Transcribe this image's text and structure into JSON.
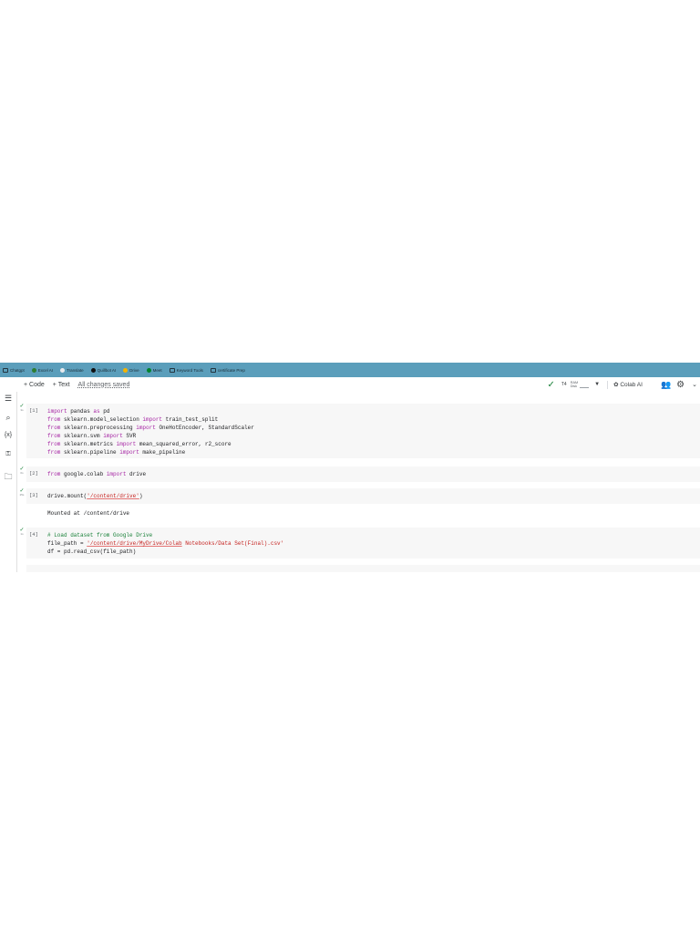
{
  "bookmarks": [
    {
      "label": "Chatgpt",
      "icon": "folder-icon",
      "color": "#24343f"
    },
    {
      "label": "Excel AI",
      "icon": "sparkle-icon",
      "color": "#2e7d32"
    },
    {
      "label": "Translate",
      "icon": "translate-icon",
      "color": "#e8eaed"
    },
    {
      "label": "Quillbot AI",
      "icon": "quillbot-icon",
      "color": "#111111"
    },
    {
      "label": "Drive",
      "icon": "drive-icon",
      "color": "#f4b400"
    },
    {
      "label": "Meet",
      "icon": "meet-icon",
      "color": "#00832d"
    },
    {
      "label": "Keyword Tools",
      "icon": "folder-icon",
      "color": "#24343f"
    },
    {
      "label": "certificate Prep",
      "icon": "folder-icon",
      "color": "#24343f"
    }
  ],
  "toolbar": {
    "add_code": "+ Code",
    "add_text": "+ Text",
    "status": "All changes saved",
    "runtime_type": "T4",
    "ram_label": "RAM",
    "disk_label": "Disk",
    "colab_ai": "Colab AI"
  },
  "cells": [
    {
      "number": "[1]",
      "time": "3s",
      "lines": [
        [
          {
            "t": "import",
            "c": "kw"
          },
          {
            "t": " pandas "
          },
          {
            "t": "as",
            "c": "kw"
          },
          {
            "t": " pd"
          }
        ],
        [
          {
            "t": "from",
            "c": "kw"
          },
          {
            "t": " sklearn.model_selection "
          },
          {
            "t": "import",
            "c": "kw"
          },
          {
            "t": " train_test_split"
          }
        ],
        [
          {
            "t": "from",
            "c": "kw"
          },
          {
            "t": " sklearn.preprocessing "
          },
          {
            "t": "import",
            "c": "kw"
          },
          {
            "t": " OneHotEncoder, StandardScaler"
          }
        ],
        [
          {
            "t": "from",
            "c": "kw"
          },
          {
            "t": " sklearn.svm "
          },
          {
            "t": "import",
            "c": "kw"
          },
          {
            "t": " SVR"
          }
        ],
        [
          {
            "t": "from",
            "c": "kw"
          },
          {
            "t": " sklearn.metrics "
          },
          {
            "t": "import",
            "c": "kw"
          },
          {
            "t": " mean_squared_error, r2_score"
          }
        ],
        [
          {
            "t": "from",
            "c": "kw"
          },
          {
            "t": " sklearn.pipeline "
          },
          {
            "t": "import",
            "c": "kw"
          },
          {
            "t": " make_pipeline"
          }
        ]
      ]
    },
    {
      "number": "[2]",
      "time": "0s",
      "lines": [
        [
          {
            "t": "from",
            "c": "kw"
          },
          {
            "t": " google.colab "
          },
          {
            "t": "import",
            "c": "kw"
          },
          {
            "t": " drive"
          }
        ]
      ]
    },
    {
      "number": "[3]",
      "time": "25s",
      "lines": [
        [
          {
            "t": "drive.mount("
          },
          {
            "t": "'/content/drive'",
            "c": "str"
          },
          {
            "t": ")"
          }
        ]
      ],
      "output": "Mounted at /content/drive"
    },
    {
      "number": "[4]",
      "time": "1s",
      "lines": [
        [
          {
            "t": "# Load dataset from Google Drive",
            "c": "cmt"
          }
        ],
        [
          {
            "t": "file_path = "
          },
          {
            "t": "'/content/drive/MyDrive/Colab",
            "c": "str"
          },
          {
            "t": " Notebooks/Data Set(Final).csv'",
            "c": "str2"
          }
        ],
        [
          {
            "t": "df = pd.read_csv(file_path)"
          }
        ]
      ]
    }
  ]
}
